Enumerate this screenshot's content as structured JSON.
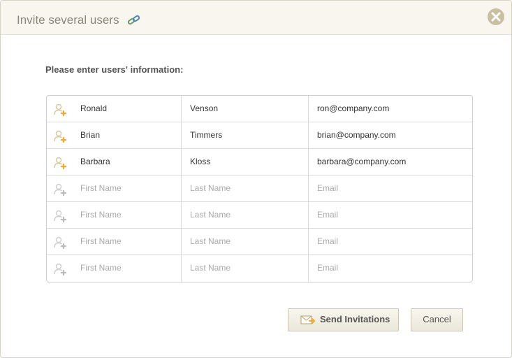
{
  "dialog": {
    "title": "Invite several users",
    "prompt": "Please enter users' information:",
    "colors": {
      "titlebar_bg": "#f8f6ef",
      "accent_orange": "#f0a830",
      "close_bg": "#c9c0a2"
    },
    "icons": {
      "title_icon": "link-icon",
      "close_icon": "close-icon",
      "row_icon": "user-add-icon",
      "send_icon": "envelope-icon"
    },
    "placeholders": {
      "first": "First Name",
      "last": "Last Name",
      "email": "Email"
    },
    "users": [
      {
        "first": "Ronald",
        "last": "Venson",
        "email": "ron@company.com"
      },
      {
        "first": "Brian",
        "last": "Timmers",
        "email": "brian@company.com"
      },
      {
        "first": "Barbara",
        "last": "Kloss",
        "email": "barbara@company.com"
      },
      {
        "first": "",
        "last": "",
        "email": ""
      },
      {
        "first": "",
        "last": "",
        "email": ""
      },
      {
        "first": "",
        "last": "",
        "email": ""
      },
      {
        "first": "",
        "last": "",
        "email": ""
      }
    ],
    "buttons": {
      "send": "Send Invitations",
      "cancel": "Cancel"
    }
  }
}
